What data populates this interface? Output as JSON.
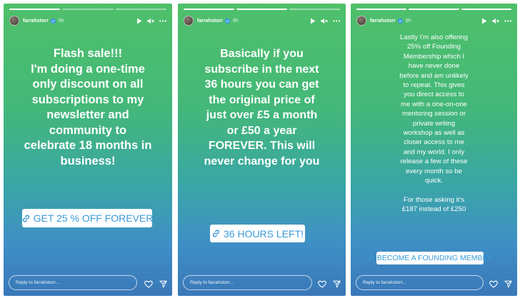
{
  "header": {
    "username": "farrahstorr",
    "time": "9h"
  },
  "stories": [
    {
      "lines": [
        "Flash sale!!!",
        "I'm doing a one-time",
        "only discount on all",
        "subscriptions to my",
        "newsletter and",
        "community to",
        "celebrate 18 months in",
        "business!"
      ],
      "sticker": "GET 25 % OFF FOREVER",
      "progress_done": 1
    },
    {
      "lines": [
        "Basically if you",
        "subscribe in the next",
        "36 hours you can get",
        "the original price of",
        "just over £5 a month",
        "or £50 a year",
        "FOREVER. This will",
        "never change for you"
      ],
      "sticker": "36 HOURS LEFT!",
      "progress_done": 2
    },
    {
      "lines": [
        "Lastly I'm also offering",
        "25% off Founding",
        "Membership which I",
        "have never done",
        "before and am unlikely",
        "to repeat. This gives",
        "you direct access to",
        "me with a one-on-one",
        "mentoring session or",
        "private writing",
        "workshop as well as",
        "closer access to me",
        "and my world. I only",
        "release a few of these",
        "every month so be",
        "quick."
      ],
      "lines2": [
        "For those asking it's",
        "£187 instead of £250"
      ],
      "sticker": "BECOME A FOUNDING MEMBER",
      "progress_done": 3
    }
  ],
  "footer": {
    "reply_placeholder": "Reply to farrahstorr..."
  },
  "colors": {
    "sticker_text": "#3a9ad9",
    "verified_badge": "#3d95ef"
  }
}
